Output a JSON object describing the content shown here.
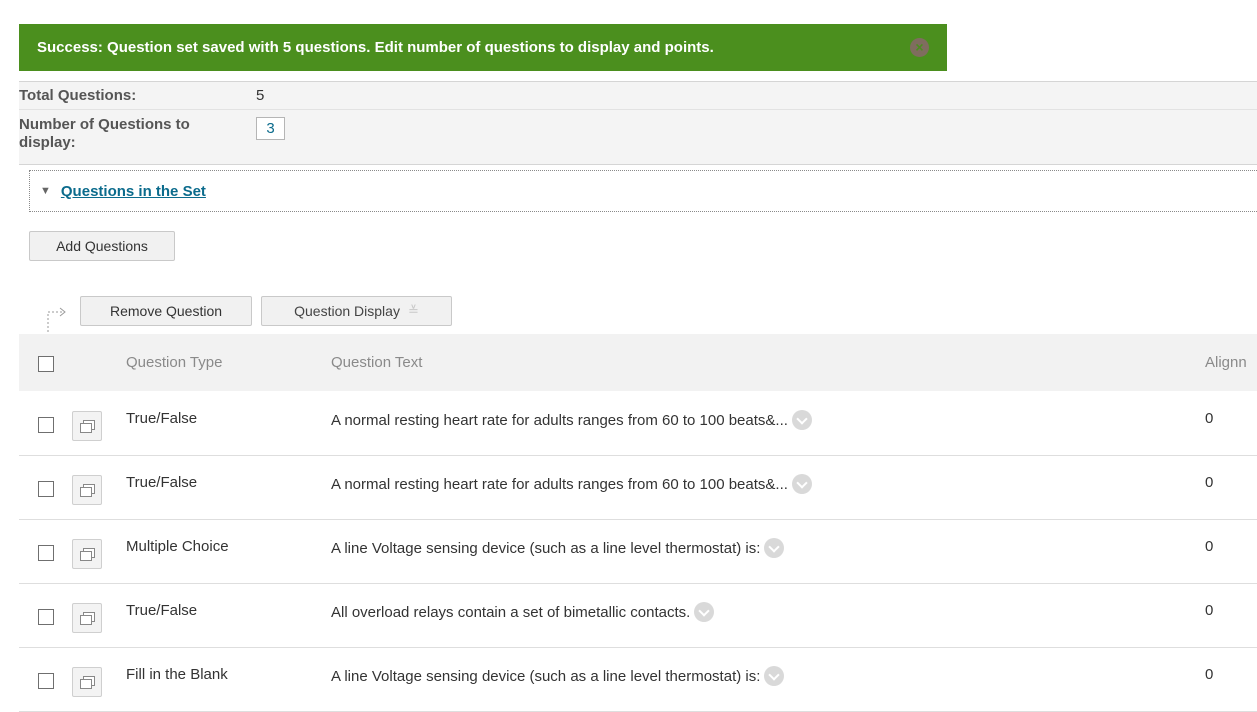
{
  "banner": {
    "message": "Success: Question set saved with 5 questions. Edit number of questions to display and points.",
    "close_icon": "close-circle-icon",
    "color": "#4b8f1e"
  },
  "summary": {
    "total_label": "Total Questions:",
    "total_value": "5",
    "display_label": "Number of Questions to display:",
    "display_value": "3"
  },
  "section": {
    "title": "Questions in the Set",
    "expand_icon": "triangle-down-icon"
  },
  "toolbar": {
    "add_questions": "Add Questions",
    "remove_question": "Remove Question",
    "question_display": "Question Display"
  },
  "table": {
    "headers": {
      "type": "Question Type",
      "text": "Question Text",
      "alignment": "Alignn"
    },
    "rows": [
      {
        "type": "True/False",
        "text": "A normal resting heart rate for adults ranges from 60 to 100 beats&...",
        "alignment": "0"
      },
      {
        "type": "True/False",
        "text": "A normal resting heart rate for adults ranges from 60 to 100 beats&...",
        "alignment": "0"
      },
      {
        "type": "Multiple Choice",
        "text": "A line Voltage sensing device (such as a line level thermostat) is:",
        "alignment": "0"
      },
      {
        "type": "True/False",
        "text": "All overload relays contain a set of bimetallic contacts.",
        "alignment": "0"
      },
      {
        "type": "Fill in the Blank",
        "text": "A line Voltage sensing device (such as a line level thermostat) is:",
        "alignment": "0"
      }
    ]
  }
}
